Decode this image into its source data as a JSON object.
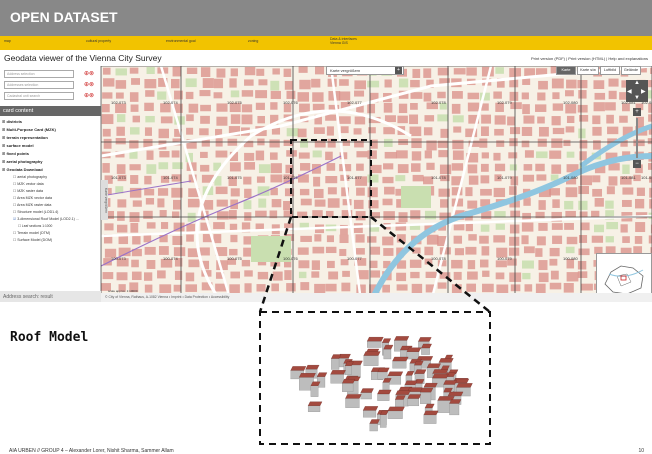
{
  "banner": {
    "title": "OPEN DATASET",
    "color": "#888888"
  },
  "yellow_bar": {
    "color": "#f2c300",
    "links": [
      "map",
      "cultural property",
      "environmental goal",
      "zoning",
      "Data & interfaces\nVienna GIS"
    ]
  },
  "viewer": {
    "title": "Geodata viewer of the Vienna City Survey",
    "top_links": "Print version (PDF) | Print version (HTML) | Help and explanations"
  },
  "panel": {
    "search_fields": [
      {
        "placeholder": "Address selection"
      },
      {
        "placeholder": "Addresses selection"
      },
      {
        "placeholder": "Cadastral unit search"
      }
    ],
    "layer_content_heading": "card content",
    "layers": [
      {
        "label": "districts",
        "level": 0,
        "checked": false
      },
      {
        "label": "Multi-Purpose Card (MZK)",
        "level": 0,
        "checked": false
      },
      {
        "label": "terrain representation",
        "level": 0,
        "checked": false
      },
      {
        "label": "surface model",
        "level": 0,
        "checked": false
      },
      {
        "label": "fixed points",
        "level": 0,
        "checked": false
      },
      {
        "label": "aerial photography",
        "level": 0,
        "checked": false
      },
      {
        "label": "Geodata Download",
        "level": 0,
        "checked": false
      },
      {
        "label": "aerial photography",
        "level": 1,
        "checked": false
      },
      {
        "label": "MZK vector data",
        "level": 1,
        "checked": false
      },
      {
        "label": "MZK raster data",
        "level": 1,
        "checked": false
      },
      {
        "label": "Area MZK vector data",
        "level": 1,
        "checked": false
      },
      {
        "label": "Area MZK raster data",
        "level": 1,
        "checked": false
      },
      {
        "label": "Structure model (LOD1.4)",
        "level": 1,
        "checked": false
      },
      {
        "label": "3-dimensional Roof Model (LOD2.1) ...",
        "level": 1,
        "checked": true
      },
      {
        "label": "Leaf sections 1:1000",
        "level": 2,
        "checked": false
      },
      {
        "label": "Terrain model (DTM)",
        "level": 1,
        "checked": false
      },
      {
        "label": "Surface Model (DOM)",
        "level": 1,
        "checked": false
      }
    ],
    "address_search_label": "Address search: result"
  },
  "map": {
    "search_button": "Karte vergrößern",
    "map_types": [
      {
        "label": "Karte",
        "active": true
      },
      {
        "label": "Karte s/w",
        "active": false
      },
      {
        "label": "Luftbild",
        "active": false
      },
      {
        "label": "Gelände",
        "active": false
      }
    ],
    "grid_labels": [
      [
        "102-073",
        "102-074",
        "102-075",
        "102-076",
        "102-077",
        "102-078",
        "102-079",
        "102-080",
        "102-081",
        "102-082"
      ],
      [
        "101-073",
        "101-074",
        "101-075",
        "101-076",
        "101-077",
        "101-078",
        "101-079",
        "101-080",
        "101-081",
        "101-082"
      ],
      [
        "100-073",
        "100-074",
        "100-075",
        "100-076",
        "100-077",
        "100-078",
        "100-079",
        "100-080",
        "100-081",
        "100-082"
      ]
    ],
    "side_tab": "Karte vergrößern",
    "footer": "© City of Vienna, Rathaus, A-1082 Vienna • Imprint • Data Protection • Accessibility",
    "scale_text": "scale approx. 1:10000",
    "colors": {
      "background": "#f7f1e6",
      "buildings": "#d98c86",
      "water": "#8fc6e0",
      "green": "#c9dfb0",
      "grid": "#444444"
    }
  },
  "callout": {
    "label": "Roof Model"
  },
  "footnote": "AIA URBEN  //  GROUP 4 – Alexander Lorer, Nishit Sharma, Sammer Allam",
  "page_number": "10"
}
